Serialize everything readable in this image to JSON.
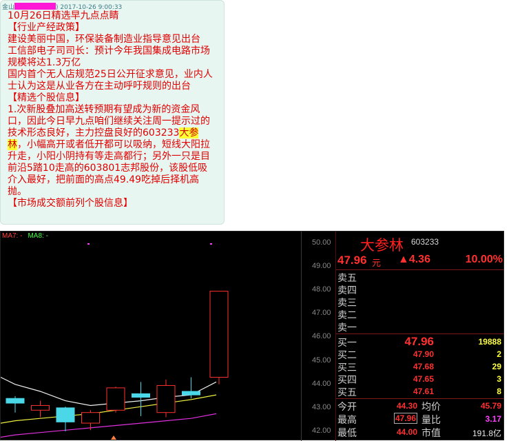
{
  "chat": {
    "sender": "金山",
    "sender_tail": ")",
    "timestamp": "2017-10-26 9:00:33",
    "lines": [
      "10月26日精选早九点点睛",
      "【行业产经政策】",
      "建设美丽中国，环保装备制造业指导意见出台",
      "工信部电子司司长：预计今年我国集成电路市场规模将达1.3万亿",
      "国内首个无人店规范25日公开征求意见，业内人士认为这是从业各方在主动呼吁规则的出台",
      "【精选个股信息】"
    ],
    "stock_paragraph": {
      "before": "1.次新股叠加高送转预期有望成为新的资金风口，因此今日早九点咱们继续关注周一提示过的技术形态良好，主力控盘良好的603233",
      "highlight": "大参林",
      "after": "，小幅高开或者低开都可以吸纳，短线大阳拉升走，小阳小阴持有等走高都行；另外一只是目前沿5踏10走高的603801志邦股份，该股低吸介入最好，把前面的高点49.49吃掉后择机高抛。"
    },
    "cut_line": "【市场成交额前列个股信息】"
  },
  "chart": {
    "ma7_label": "MA7: -",
    "ma8_label": "MA8: -",
    "y_ticks": [
      "50.00",
      "49.00",
      "48.00",
      "47.00",
      "46.00",
      "45.00",
      "44.00",
      "43.00",
      "42.00"
    ]
  },
  "quote": {
    "name": "大参林",
    "code": "603233",
    "price": "47.96",
    "unit": "元",
    "change": "▲4.36",
    "change_pct": "10.00%",
    "asks": [
      {
        "label": "卖五",
        "price": "",
        "volume": ""
      },
      {
        "label": "卖四",
        "price": "",
        "volume": ""
      },
      {
        "label": "卖三",
        "price": "",
        "volume": ""
      },
      {
        "label": "卖二",
        "price": "",
        "volume": ""
      },
      {
        "label": "卖一",
        "price": "",
        "volume": ""
      }
    ],
    "bids": [
      {
        "label": "买一",
        "price": "47.96",
        "volume": "19888"
      },
      {
        "label": "买二",
        "price": "47.90",
        "volume": "2"
      },
      {
        "label": "买三",
        "price": "47.68",
        "volume": "29"
      },
      {
        "label": "买四",
        "price": "47.65",
        "volume": "3"
      },
      {
        "label": "买五",
        "price": "47.61",
        "volume": "8"
      }
    ],
    "stats": [
      {
        "label": "今开",
        "value": "44.30",
        "label2": "均价",
        "value2": "45.79"
      },
      {
        "label": "最高",
        "value": "47.96",
        "label2": "量比",
        "value2": "3.17"
      },
      {
        "label": "最低",
        "value": "44.00",
        "label2": "市值",
        "value2": "191.8亿"
      }
    ]
  },
  "chart_data": {
    "type": "candlestick",
    "ylim": [
      41.8,
      50.4
    ],
    "candles": [
      {
        "open": 43.4,
        "close": 43.2,
        "high": 43.5,
        "low": 42.8,
        "color": "cyan"
      },
      {
        "open": 43.1,
        "close": 42.9,
        "high": 43.3,
        "low": 42.6,
        "color": "red"
      },
      {
        "open": 43.0,
        "close": 42.4,
        "high": 43.05,
        "low": 42.0,
        "color": "cyan"
      },
      {
        "open": 42.35,
        "close": 42.8,
        "high": 42.9,
        "low": 42.05,
        "color": "red"
      },
      {
        "open": 42.9,
        "close": 43.85,
        "high": 43.9,
        "low": 42.8,
        "color": "red"
      },
      {
        "open": 43.6,
        "close": 43.45,
        "high": 44.1,
        "low": 42.65,
        "color": "cyan"
      },
      {
        "open": 42.8,
        "close": 43.95,
        "high": 44.2,
        "low": 42.6,
        "color": "red"
      },
      {
        "open": 43.7,
        "close": 43.55,
        "high": 44.3,
        "low": 43.4,
        "color": "cyan"
      },
      {
        "open": 44.3,
        "close": 47.96,
        "high": 47.96,
        "low": 44.0,
        "color": "red"
      }
    ],
    "ma_white": [
      44.0,
      43.7,
      43.3,
      43.1,
      43.2,
      43.3,
      43.45,
      43.55,
      44.1
    ],
    "ma_yellow": [
      42.45,
      42.55,
      42.65,
      42.75,
      42.9,
      43.05,
      43.2,
      43.35,
      43.55
    ],
    "ma_magenta": [
      41.85,
      41.95,
      42.05,
      42.15,
      42.25,
      42.35,
      42.45,
      42.55,
      42.75
    ]
  }
}
